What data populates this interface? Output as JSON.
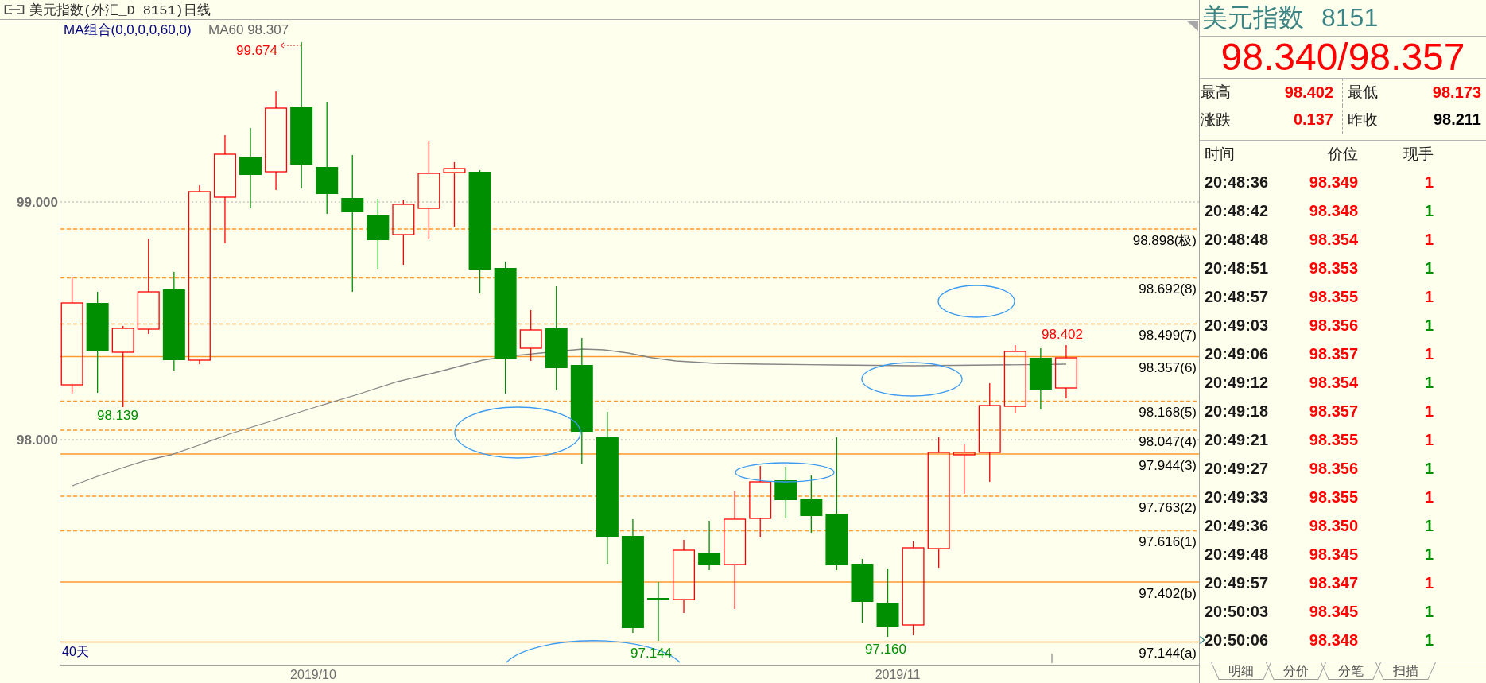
{
  "title_bar": {
    "title": "美元指数(外汇_D 8151)日线"
  },
  "chart": {
    "legend": {
      "indicator": "MA组合(0,0,0,0,60,0)",
      "ma_value": "MA60 98.307"
    },
    "y_axis_labels": [
      "99.000",
      "98.000"
    ],
    "price_levels": [
      {
        "label": "98.898(极)",
        "kind": "dashed"
      },
      {
        "label": "98.692(8)",
        "kind": "dashed"
      },
      {
        "label": "98.499(7)",
        "kind": "dashed"
      },
      {
        "label": "98.357(6)",
        "kind": "solid"
      },
      {
        "label": "98.168(5)",
        "kind": "dashed"
      },
      {
        "label": "98.047(4)",
        "kind": "dashed"
      },
      {
        "label": "97.944(3)",
        "kind": "solid"
      },
      {
        "label": "97.763(2)",
        "kind": "dashed"
      },
      {
        "label": "97.616(1)",
        "kind": "dashed"
      },
      {
        "label": "97.402(b)",
        "kind": "solid"
      },
      {
        "label": "97.144(a)",
        "kind": "solid"
      }
    ],
    "annotations": [
      {
        "label": "99.674",
        "color": "#ff0000",
        "kind": "arrow"
      },
      {
        "label": "98.139",
        "color": "#008f00",
        "kind": "plain"
      },
      {
        "label": "97.144",
        "color": "#008f00",
        "kind": "plain"
      },
      {
        "label": "97.160",
        "color": "#008f00",
        "kind": "plain"
      },
      {
        "label": "98.402",
        "color": "#ff0000",
        "kind": "plain"
      }
    ],
    "period": "40天",
    "x_axis_labels": [
      "2019/10",
      "2019/11"
    ]
  },
  "quote": {
    "name": "美元指数",
    "code": "8151",
    "price": "98.340/98.357",
    "stats": [
      {
        "label": "最高",
        "value": "98.402",
        "color": "#ff0000"
      },
      {
        "label": "最低",
        "value": "98.173",
        "color": "#ff0000"
      },
      {
        "label": "涨跌",
        "value": "0.137",
        "color": "#ff0000"
      },
      {
        "label": "昨收",
        "value": "98.211",
        "color": "#000000"
      }
    ],
    "ticks": {
      "columns": [
        "时间",
        "价位",
        "现手"
      ],
      "rows": [
        {
          "time": "20:48:36",
          "price": "98.349",
          "volume": "1",
          "color": "#ff0000",
          "selected": false
        },
        {
          "time": "20:48:42",
          "price": "98.348",
          "volume": "1",
          "color": "#008f00",
          "selected": false
        },
        {
          "time": "20:48:48",
          "price": "98.354",
          "volume": "1",
          "color": "#ff0000",
          "selected": false
        },
        {
          "time": "20:48:51",
          "price": "98.353",
          "volume": "1",
          "color": "#008f00",
          "selected": false
        },
        {
          "time": "20:48:57",
          "price": "98.355",
          "volume": "1",
          "color": "#ff0000",
          "selected": false
        },
        {
          "time": "20:49:03",
          "price": "98.356",
          "volume": "1",
          "color": "#008f00",
          "selected": false
        },
        {
          "time": "20:49:06",
          "price": "98.357",
          "volume": "1",
          "color": "#ff0000",
          "selected": false
        },
        {
          "time": "20:49:12",
          "price": "98.354",
          "volume": "1",
          "color": "#008f00",
          "selected": false
        },
        {
          "time": "20:49:18",
          "price": "98.357",
          "volume": "1",
          "color": "#ff0000",
          "selected": false
        },
        {
          "time": "20:49:21",
          "price": "98.355",
          "volume": "1",
          "color": "#ff0000",
          "selected": false
        },
        {
          "time": "20:49:27",
          "price": "98.356",
          "volume": "1",
          "color": "#008f00",
          "selected": false
        },
        {
          "time": "20:49:33",
          "price": "98.355",
          "volume": "1",
          "color": "#ff0000",
          "selected": false
        },
        {
          "time": "20:49:36",
          "price": "98.350",
          "volume": "1",
          "color": "#008f00",
          "selected": false
        },
        {
          "time": "20:49:48",
          "price": "98.345",
          "volume": "1",
          "color": "#008f00",
          "selected": false
        },
        {
          "time": "20:49:57",
          "price": "98.347",
          "volume": "1",
          "color": "#ff0000",
          "selected": false
        },
        {
          "time": "20:50:03",
          "price": "98.345",
          "volume": "1",
          "color": "#008f00",
          "selected": false
        },
        {
          "time": "20:50:06",
          "price": "98.348",
          "volume": "1",
          "color": "#008f00",
          "selected": true
        }
      ]
    },
    "tabs": [
      "明细",
      "分价",
      "分笔",
      "扫描"
    ]
  }
}
